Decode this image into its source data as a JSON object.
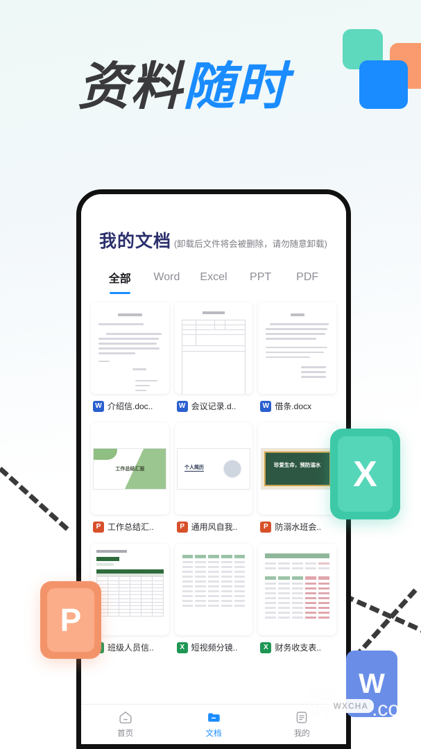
{
  "page": {
    "background_gradient_from": "#eef8f6",
    "background_gradient_to": "#ffffff"
  },
  "headline": {
    "part_dark": "资料",
    "part_blue": "随时",
    "color_dark": "#3a3a3c",
    "color_blue": "#1a8cff"
  },
  "decor": {
    "square_teal": "#5ed9bd",
    "square_orange": "#f99b6e",
    "square_blue": "#1a8cff",
    "dash_color": "#3a3a3a"
  },
  "phone": {
    "header": {
      "title": "我的文档",
      "subtitle": "(卸载后文件将会被删除，请勿随意卸载)",
      "title_color": "#2b2f6b"
    },
    "tabs": [
      {
        "label": "全部",
        "active": true
      },
      {
        "label": "Word",
        "active": false
      },
      {
        "label": "Excel",
        "active": false
      },
      {
        "label": "PPT",
        "active": false
      },
      {
        "label": "PDF",
        "active": false
      }
    ],
    "tab_accent": "#1a8cff",
    "files": [
      {
        "name": "介绍信.doc..",
        "type": "word",
        "icon_letter": "W",
        "thumb": "document"
      },
      {
        "name": "会议记录.d..",
        "type": "word",
        "icon_letter": "W",
        "thumb": "form"
      },
      {
        "name": "借条.docx",
        "type": "word",
        "icon_letter": "W",
        "thumb": "document"
      },
      {
        "name": "工作总结汇..",
        "type": "ppt",
        "icon_letter": "P",
        "thumb": "ppt-green",
        "slide_text": "工作总结汇报"
      },
      {
        "name": "通用风自我..",
        "type": "ppt",
        "icon_letter": "P",
        "thumb": "ppt-resume",
        "slide_text": "个人简历"
      },
      {
        "name": "防溺水班会..",
        "type": "ppt",
        "icon_letter": "P",
        "thumb": "ppt-board",
        "slide_text": "珍爱生命，预防溺水"
      },
      {
        "name": "班级人员信..",
        "type": "excel",
        "icon_letter": "X",
        "thumb": "xls-table"
      },
      {
        "name": "短视频分镜..",
        "type": "excel",
        "icon_letter": "X",
        "thumb": "xls-plain"
      },
      {
        "name": "财务收支表..",
        "type": "excel",
        "icon_letter": "X",
        "thumb": "xls-finance"
      }
    ],
    "icon_colors": {
      "word": "#2b5fd0",
      "ppt": "#d8502b",
      "excel": "#1f9655"
    },
    "bottom_nav": [
      {
        "label": "首页",
        "icon": "home-icon",
        "active": false
      },
      {
        "label": "文档",
        "icon": "document-icon",
        "active": true
      },
      {
        "label": "我的",
        "icon": "profile-icon",
        "active": false
      }
    ],
    "nav_active_color": "#1a8cff",
    "nav_inactive_color": "#8a8a93"
  },
  "badges": [
    {
      "letter": "X",
      "name": "excel-badge",
      "color": "#3dc9a8"
    },
    {
      "letter": "P",
      "name": "powerpoint-badge",
      "color": "#f3936a"
    },
    {
      "letter": "W",
      "name": "word-badge",
      "color": "#6a8ee8"
    }
  ],
  "watermark": {
    "cn": "微",
    "bubble": "WXCHA",
    "domain": ".com"
  }
}
